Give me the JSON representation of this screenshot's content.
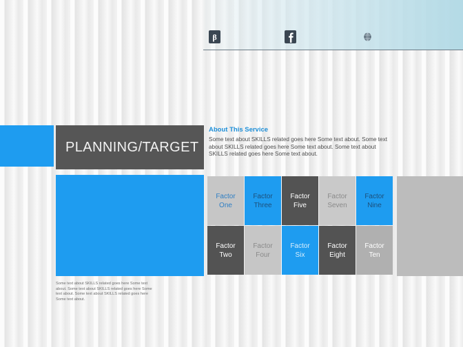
{
  "header": {
    "social_links": [
      {
        "name": "behance-icon",
        "label": "Behance",
        "glyph": "behance"
      },
      {
        "name": "facebook-icon",
        "label": "Facebook",
        "glyph": "facebook"
      },
      {
        "name": "globe-icon",
        "label": "Website",
        "glyph": "globe"
      }
    ]
  },
  "title_bar": {
    "title": "PLANNING/TARGET"
  },
  "about": {
    "heading": "About This Service",
    "body": "Some text about SKILLS related goes here Some text about. Some text about SKILLS related goes here Some text about. Some text about SKILLS related goes here Some text about."
  },
  "footer": {
    "body": "Some text about SKILLS related goes here Some text about. Some text about SKILLS related goes here Some text about. Some text about SKILLS related goes here Some text about."
  },
  "factors": [
    {
      "line1": "Factor",
      "line2": "One",
      "bg": "t-lightgray",
      "fg": "tx-blue"
    },
    {
      "line1": "Factor",
      "line2": "Three",
      "bg": "t-blue",
      "fg": "tx-navy"
    },
    {
      "line1": "Factor",
      "line2": "Five",
      "bg": "t-darkgray",
      "fg": "tx-white"
    },
    {
      "line1": "Factor",
      "line2": "Seven",
      "bg": "t-paleg",
      "fg": "tx-gray"
    },
    {
      "line1": "Factor",
      "line2": "Nine",
      "bg": "t-blue",
      "fg": "tx-navy"
    },
    {
      "line1": "Factor",
      "line2": "Two",
      "bg": "t-darkgray",
      "fg": "tx-white"
    },
    {
      "line1": "Factor",
      "line2": "Four",
      "bg": "t-lightgray",
      "fg": "tx-gray"
    },
    {
      "line1": "Factor",
      "line2": "Six",
      "bg": "t-blue",
      "fg": "tx-pale"
    },
    {
      "line1": "Factor",
      "line2": "Eight",
      "bg": "t-darkgray",
      "fg": "tx-white"
    },
    {
      "line1": "Factor",
      "line2": "Ten",
      "bg": "t-midgray",
      "fg": "tx-white"
    }
  ],
  "colors": {
    "accent_blue": "#1e9cf0",
    "dark_gray": "#565656",
    "light_gray": "#c6c6c6",
    "heading_blue": "#1e8fd8"
  }
}
